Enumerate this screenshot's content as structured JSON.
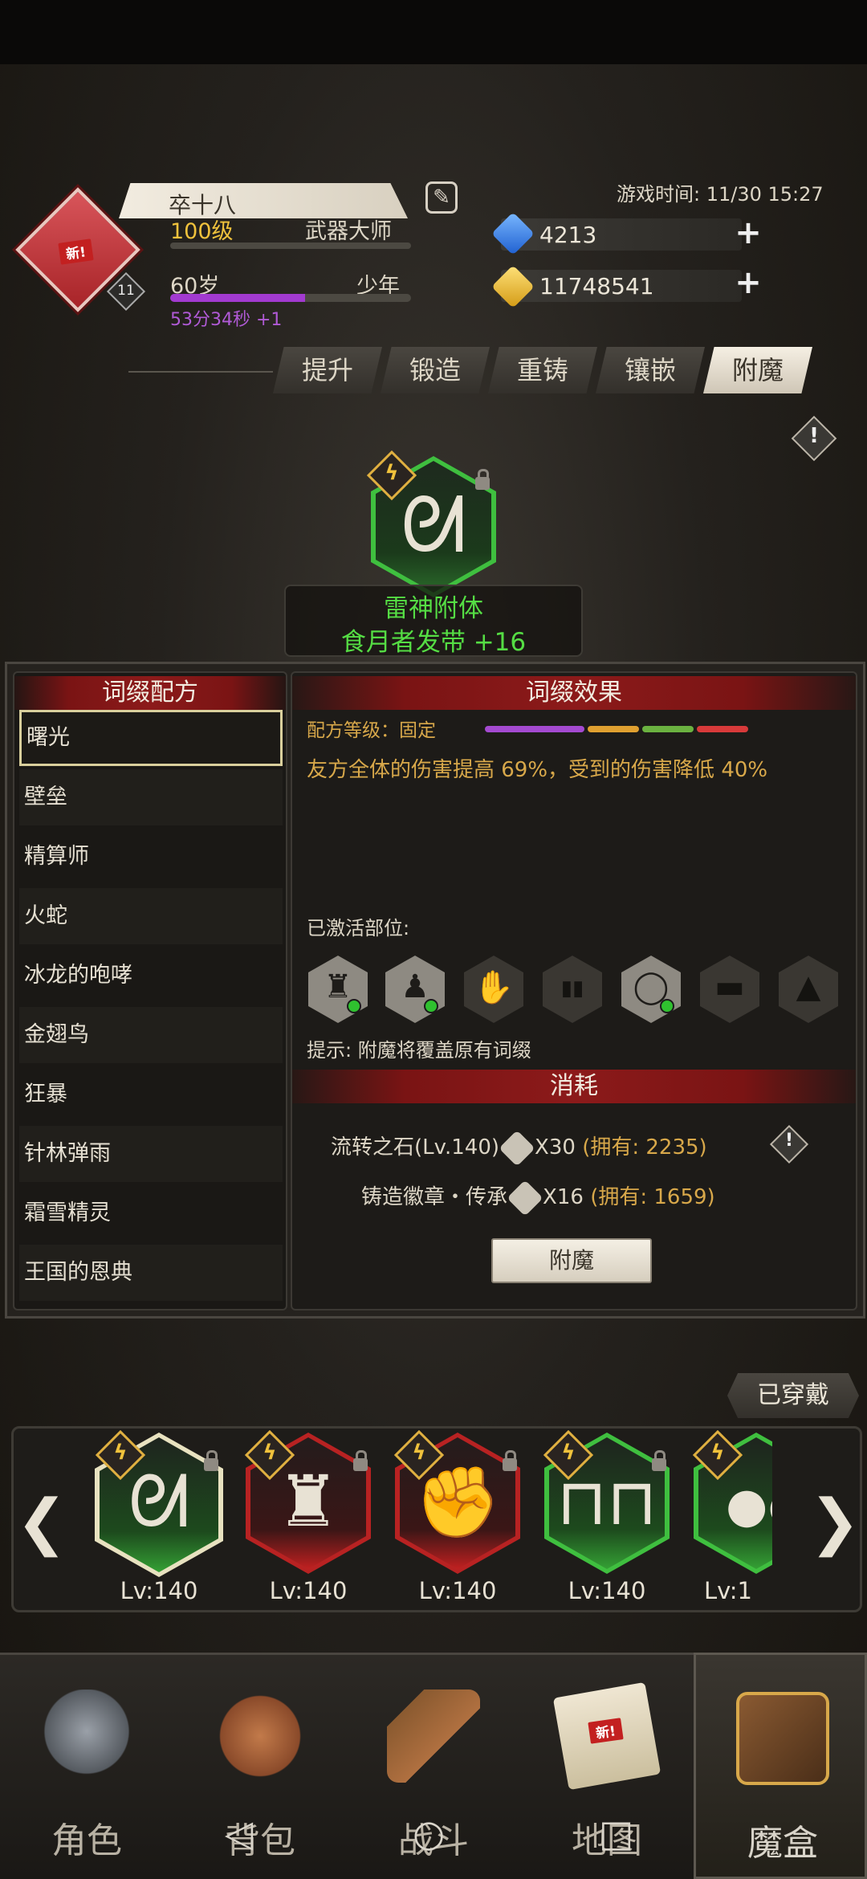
{
  "player": {
    "name": "卒十八",
    "level_text": "100级",
    "title": "武器大师",
    "age": "60岁",
    "stage": "少年",
    "timer": "53分34秒 +1",
    "badge_level": "11",
    "new_tag": "新!",
    "age_progress": 0.56
  },
  "game_time": "游戏时间: 11/30 15:27",
  "currency": {
    "diamonds": "4213",
    "gold": "11748541"
  },
  "tabs": [
    "提升",
    "锻造",
    "重铸",
    "镶嵌",
    "附魔"
  ],
  "active_tab": "附魔",
  "featured_item": {
    "enchant_name": "雷神附体",
    "item_name": "食月者发带 +16"
  },
  "affix_list": {
    "header": "词缀配方",
    "items": [
      "曙光",
      "壁垒",
      "精算师",
      "火蛇",
      "冰龙的咆哮",
      "金翅鸟",
      "狂暴",
      "针林弹雨",
      "霜雪精灵",
      "王国的恩典"
    ],
    "selected": "曙光"
  },
  "affix_effect": {
    "header": "词缀效果",
    "recipe_level": "配方等级：固定",
    "description": "友方全体的伤害提高 69%，受到的伤害降低 40%",
    "activated_label": "已激活部位:",
    "slots": [
      {
        "icon": "helmet-icon",
        "active": true,
        "glyph": "♜"
      },
      {
        "icon": "armor-icon",
        "active": true,
        "glyph": "♟"
      },
      {
        "icon": "gloves-icon",
        "active": false,
        "glyph": "✋"
      },
      {
        "icon": "boots-icon",
        "active": false,
        "glyph": "▮▮"
      },
      {
        "icon": "ring-icon",
        "active": true,
        "glyph": "◯"
      },
      {
        "icon": "belt-icon",
        "active": false,
        "glyph": "▬"
      },
      {
        "icon": "cloak-icon",
        "active": false,
        "glyph": "▲"
      }
    ],
    "hint": "提示: 附魔将覆盖原有词缀"
  },
  "consume": {
    "header": "消耗",
    "line1_name": "流转之石(Lv.140)",
    "line1_qty": "X30",
    "line1_owned": "(拥有: 2235)",
    "line2_name": "铸造徽章・传承",
    "line2_qty": "X16",
    "line2_owned": "(拥有: 1659)",
    "button": "附魔"
  },
  "equipped": {
    "tag": "已穿戴",
    "items": [
      {
        "name": "headband",
        "level": "Lv:140",
        "rarity": "green"
      },
      {
        "name": "armor",
        "level": "Lv:140",
        "rarity": "red"
      },
      {
        "name": "gauntlet",
        "level": "Lv:140",
        "rarity": "red"
      },
      {
        "name": "boots",
        "level": "Lv:140",
        "rarity": "green"
      },
      {
        "name": "accessory",
        "level": "Lv:1",
        "rarity": "green"
      }
    ]
  },
  "nav": {
    "items": [
      "角色",
      "背包",
      "战斗",
      "地图",
      "魔盒"
    ],
    "active": "魔盒",
    "map_new_tag": "新!"
  },
  "colors": {
    "accent_gold": "#f0c23c",
    "green_text": "#55dd44",
    "effect_text": "#d8a84a",
    "header_red": "#8c1a1a"
  }
}
